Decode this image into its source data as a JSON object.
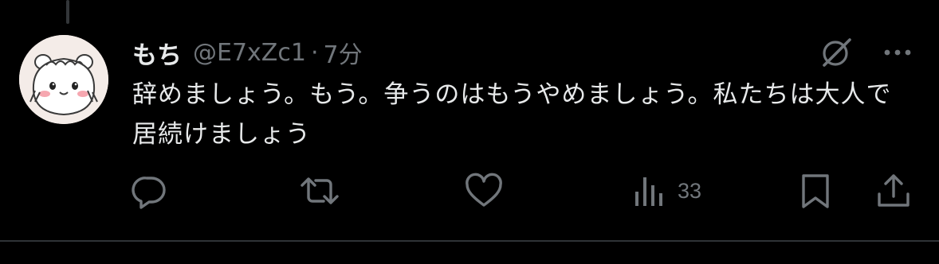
{
  "tweet": {
    "display_name": "もち",
    "handle": "@E7xZc1",
    "separator": "·",
    "time": "7分",
    "text": "辞めましょう。もう。争うのはもうやめましょう。私たちは大人で居続けましょう",
    "avatar_icon": "hamster-character-avatar"
  },
  "actions": {
    "reply_icon": "reply-icon",
    "retweet_icon": "retweet-icon",
    "like_icon": "heart-icon",
    "views_icon": "views-chart-icon",
    "views_count": "33",
    "bookmark_icon": "bookmark-icon",
    "share_icon": "share-icon"
  },
  "colors": {
    "background": "#000000",
    "text_primary": "#e7e9ea",
    "text_secondary": "#71767b",
    "divider": "#2f3336"
  }
}
